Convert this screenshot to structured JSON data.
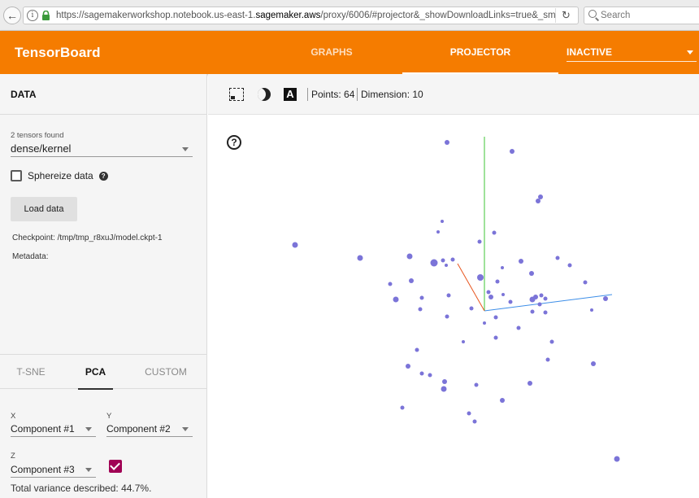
{
  "browser": {
    "url_prefix": "https://sagemakerworkshop.notebook.us-east-1.",
    "url_domain": "sagemaker.aws",
    "url_suffix": "/proxy/6006/#projector&_showDownloadLinks=true&_smoothi",
    "search_placeholder": "Search"
  },
  "header": {
    "title": "TensorBoard",
    "tabs": [
      "GRAPHS",
      "PROJECTOR"
    ],
    "run_select": "INACTIVE"
  },
  "data_panel": {
    "heading": "DATA",
    "tensors_found": "2 tensors found",
    "tensor": "dense/kernel",
    "sphereize_label": "Sphereize data",
    "load_button": "Load data",
    "checkpoint": "Checkpoint: /tmp/tmp_r8xuJ/model.ckpt-1",
    "metadata": "Metadata:"
  },
  "projection": {
    "tabs": [
      "T-SNE",
      "PCA",
      "CUSTOM"
    ],
    "x_label": "X",
    "x_value": "Component #1",
    "y_label": "Y",
    "y_value": "Component #2",
    "z_label": "Z",
    "z_value": "Component #3",
    "z_enabled": true,
    "variance": "Total variance described: 44.7%."
  },
  "toolbar": {
    "points": "Points: 64",
    "dimension": "Dimension: 10"
  },
  "scatter": {
    "point_color": "#7b74d8",
    "axis_colors": {
      "x": "#3d8ee8",
      "y": "#3fc436",
      "z": "#e8551e"
    }
  }
}
